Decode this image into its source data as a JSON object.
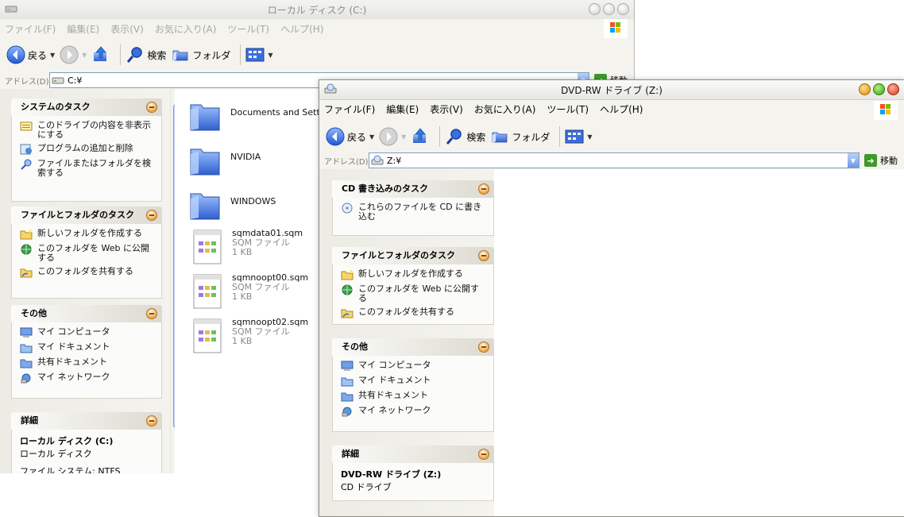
{
  "win1": {
    "title": "ローカル ディスク (C:)",
    "menu": [
      "ファイル(F)",
      "編集(E)",
      "表示(V)",
      "お気に入り(A)",
      "ツール(T)",
      "ヘルプ(H)"
    ],
    "toolbar": {
      "back": "戻る",
      "search": "検索",
      "folders": "フォルダ"
    },
    "address_label": "アドレス(D)",
    "address_value": "C:¥",
    "go_label": "移動",
    "tasks": {
      "system": {
        "title": "システムのタスク",
        "items": [
          "このドライブの内容を非表示にする",
          "プログラムの追加と削除",
          "ファイルまたはフォルダを検索する"
        ]
      },
      "file_folder": {
        "title": "ファイルとフォルダのタスク",
        "items": [
          "新しいフォルダを作成する",
          "このフォルダを Web に公開する",
          "このフォルダを共有する"
        ]
      },
      "other": {
        "title": "その他",
        "items": [
          "マイ コンピュータ",
          "マイ ドキュメント",
          "共有ドキュメント",
          "マイ ネットワーク"
        ]
      },
      "details": {
        "title": "詳細",
        "name": "ローカル ディスク (C:)",
        "type": "ローカル ディスク",
        "fs": "ファイル システム: NTFS"
      }
    },
    "files": [
      {
        "name": "Documents and Settin",
        "kind": "folder"
      },
      {
        "name": "NVIDIA",
        "kind": "folder"
      },
      {
        "name": "WINDOWS",
        "kind": "folder"
      },
      {
        "name": "sqmdata01.sqm",
        "type": "SQM ファイル",
        "size": "1 KB",
        "kind": "file"
      },
      {
        "name": "sqmnoopt00.sqm",
        "type": "SQM ファイル",
        "size": "1 KB",
        "kind": "file"
      },
      {
        "name": "sqmnoopt02.sqm",
        "type": "SQM ファイル",
        "size": "1 KB",
        "kind": "file"
      }
    ]
  },
  "win2": {
    "title": "DVD-RW ドライブ (Z:)",
    "menu": [
      "ファイル(F)",
      "編集(E)",
      "表示(V)",
      "お気に入り(A)",
      "ツール(T)",
      "ヘルプ(H)"
    ],
    "toolbar": {
      "back": "戻る",
      "search": "検索",
      "folders": "フォルダ"
    },
    "address_label": "アドレス(D)",
    "address_value": "Z:¥",
    "go_label": "移動",
    "tasks": {
      "cd": {
        "title": "CD 書き込みのタスク",
        "items": [
          "これらのファイルを CD に書き込む"
        ]
      },
      "file_folder": {
        "title": "ファイルとフォルダのタスク",
        "items": [
          "新しいフォルダを作成する",
          "このフォルダを Web に公開する",
          "このフォルダを共有する"
        ]
      },
      "other": {
        "title": "その他",
        "items": [
          "マイ コンピュータ",
          "マイ ドキュメント",
          "共有ドキュメント",
          "マイ ネットワーク"
        ]
      },
      "details": {
        "title": "詳細",
        "name": "DVD-RW ドライブ (Z:)",
        "type": "CD ドライブ"
      }
    }
  },
  "colors": {
    "accent": "#3d6ee0",
    "xp_orange": "#f0a43a",
    "folder_blue": "#3c6cd6"
  }
}
